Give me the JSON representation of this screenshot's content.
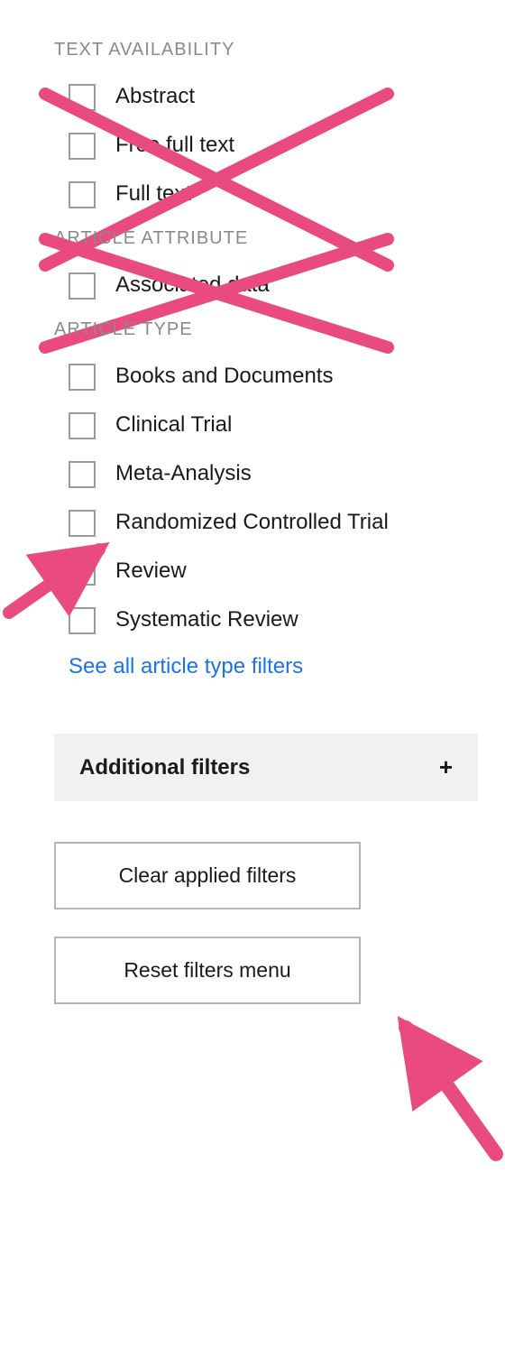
{
  "filters": {
    "text_availability": {
      "header": "TEXT AVAILABILITY",
      "items": [
        {
          "label": "Abstract"
        },
        {
          "label": "Free full text"
        },
        {
          "label": "Full text"
        }
      ]
    },
    "article_attribute": {
      "header": "ARTICLE ATTRIBUTE",
      "items": [
        {
          "label": "Associated data"
        }
      ]
    },
    "article_type": {
      "header": "ARTICLE TYPE",
      "items": [
        {
          "label": "Books and Documents"
        },
        {
          "label": "Clinical Trial"
        },
        {
          "label": "Meta-Analysis"
        },
        {
          "label": "Randomized Controlled Trial"
        },
        {
          "label": "Review"
        },
        {
          "label": "Systematic Review"
        }
      ],
      "see_all_link": "See all article type filters"
    }
  },
  "additional_filters": {
    "label": "Additional filters"
  },
  "buttons": {
    "clear": "Clear applied filters",
    "reset": "Reset filters menu"
  },
  "annotations": {
    "color": "#e94b7f"
  }
}
